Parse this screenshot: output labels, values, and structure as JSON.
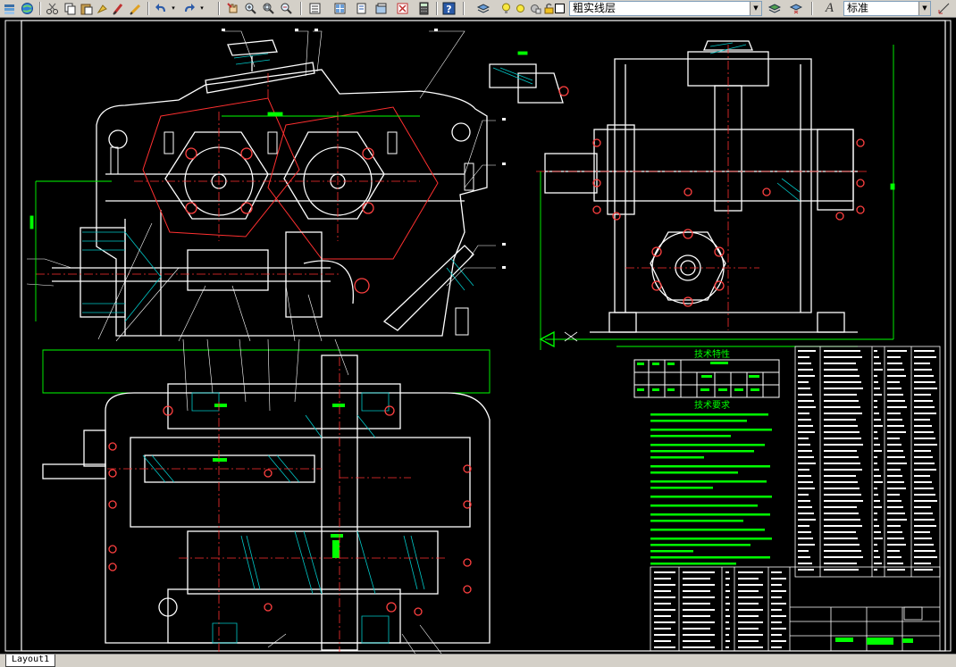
{
  "toolbar": {
    "icons": [
      "layers-icon",
      "globe-icon",
      "cut-icon",
      "copy-icon",
      "paste-icon",
      "match-properties-icon",
      "brush-icon",
      "undo-icon",
      "redo-icon",
      "pan-icon",
      "zoom-realtime-icon",
      "zoom-window-icon",
      "zoom-previous-icon",
      "properties-icon",
      "design-center-icon",
      "tool-palettes-icon",
      "sheet-set-icon",
      "markup-icon",
      "calculator-icon",
      "help-icon"
    ],
    "layer_name": "粗实线层",
    "text_style": "标准",
    "text_style_letter": "A"
  },
  "drawing": {
    "tech_char_title": "技术特性",
    "tech_req_title": "技术要求",
    "colors": {
      "background": "#000000",
      "outline": "#ffffff",
      "centerline": "#ff0000",
      "dimension": "#00ff00",
      "hatch": "#00c8c8",
      "bolt": "#ff4040"
    }
  },
  "tabs": {
    "layout_label": "Layout1"
  }
}
